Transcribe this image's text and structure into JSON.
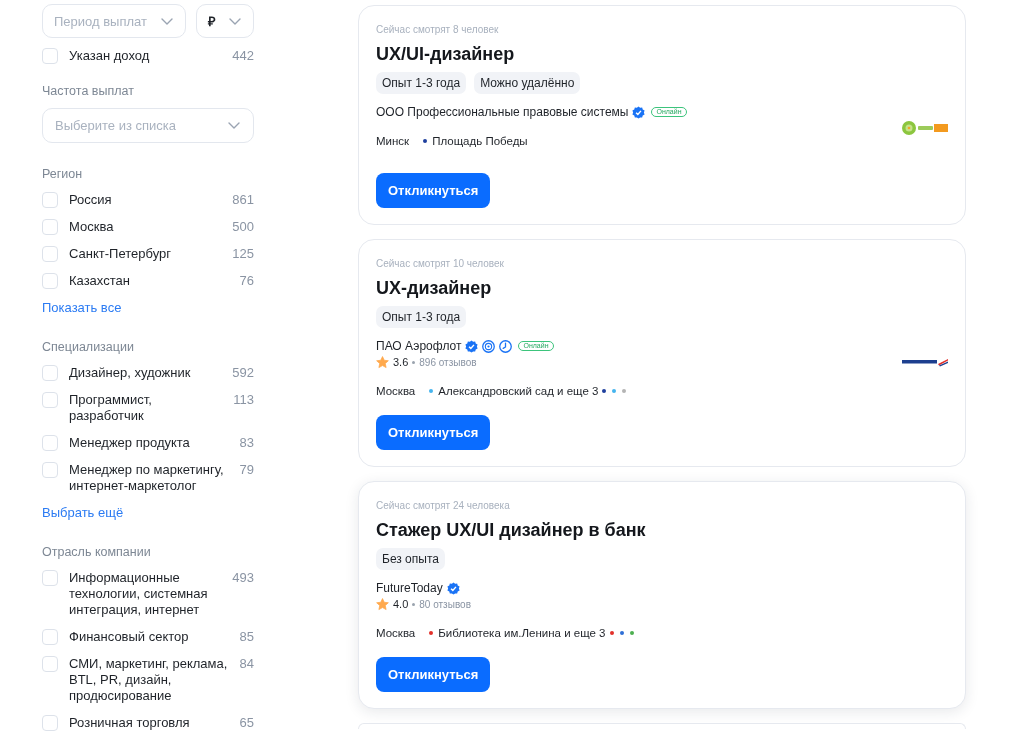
{
  "filters": {
    "salary_period": {
      "placeholder": "Период выплат"
    },
    "currency": {
      "value": "₽"
    },
    "income_specified": {
      "label": "Указан доход",
      "count": "442",
      "checked": false
    },
    "sections": [
      {
        "kind": "select",
        "title": "Частота выплат",
        "placeholder": "Выберите из списка"
      },
      {
        "kind": "checklist",
        "title": "Регион",
        "items": [
          {
            "label": "Россия",
            "count": "861",
            "checked": false
          },
          {
            "label": "Москва",
            "count": "500",
            "checked": false
          },
          {
            "label": "Санкт-Петербург",
            "count": "125",
            "checked": false
          },
          {
            "label": "Казахстан",
            "count": "76",
            "checked": false
          }
        ],
        "link": "Показать все"
      },
      {
        "kind": "checklist",
        "title": "Специализации",
        "items": [
          {
            "label": "Дизайнер, художник",
            "count": "592",
            "checked": false
          },
          {
            "label": "Программист, разработчик",
            "count": "113",
            "checked": false
          },
          {
            "label": "Менеджер продукта",
            "count": "83",
            "checked": false
          },
          {
            "label": "Менеджер по маркетингу, интернет-маркетолог",
            "count": "79",
            "checked": false
          }
        ],
        "link": "Выбрать ещё"
      },
      {
        "kind": "checklist",
        "title": "Отрасль компании",
        "items": [
          {
            "label": "Информационные технологии, системная интеграция, интернет",
            "count": "493",
            "checked": false
          },
          {
            "label": "Финансовый сектор",
            "count": "85",
            "checked": false
          },
          {
            "label": "СМИ, маркетинг, реклама, BTL, PR, дизайн, продюсирование",
            "count": "84",
            "checked": false
          },
          {
            "label": "Розничная торговля",
            "count": "65",
            "checked": false
          }
        ]
      }
    ]
  },
  "vacancies": [
    {
      "viewers": "Сейчас смотрят 8 человек",
      "title": "UX/UI-дизайнер",
      "tags": [
        "Опыт 1-3 года",
        "Можно удалённо"
      ],
      "company": "ООО Профессиональные правовые системы",
      "verified": true,
      "online_label": "Онлайн",
      "city": "Минск",
      "metro": {
        "station": "Площадь Победы",
        "color": "#1e3f9e"
      },
      "logo": {
        "kind": "round"
      },
      "button": "Откликнуться",
      "highlighted": false
    },
    {
      "viewers": "Сейчас смотрят 10 человек",
      "title": "UX-дизайнер",
      "tags": [
        "Опыт 1-3 года"
      ],
      "company": "ПАО Аэрофлот",
      "verified": true,
      "badges": [
        {
          "kind": "ring"
        },
        {
          "kind": "clock"
        }
      ],
      "online_label": "Онлайн",
      "rating": {
        "score": "3.6",
        "reviews": "896 отзывов"
      },
      "city": "Москва",
      "metro": {
        "station": "Александровский сад и еще 3",
        "color": "#45b4ee",
        "more_lines": [
          {
            "color": "#1e3f9e"
          },
          {
            "color": "#45b4ee"
          },
          {
            "color": "#b4b4b4"
          }
        ]
      },
      "logo": {
        "kind": "wordmark"
      },
      "button": "Откликнуться",
      "highlighted": false
    },
    {
      "viewers": "Сейчас смотрят 24 человека",
      "title": "Стажер UX/UI дизайнер в банк",
      "tags": [
        "Без опыта"
      ],
      "company": "FutureToday",
      "verified": true,
      "rating": {
        "score": "4.0",
        "reviews": "80 отзывов"
      },
      "city": "Москва",
      "metro": {
        "station": "Библиотека им.Ленина и еще 3",
        "color": "#e2302a",
        "more_lines": [
          {
            "color": "#e2302a"
          },
          {
            "color": "#2f6fd6"
          },
          {
            "color": "#4caf50"
          }
        ]
      },
      "button": "Откликнуться",
      "highlighted": true
    }
  ]
}
